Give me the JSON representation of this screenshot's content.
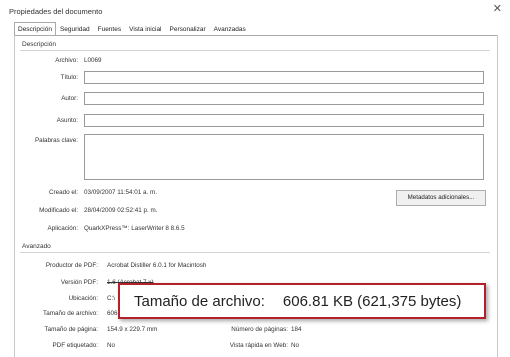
{
  "window": {
    "title": "Propiedades del documento"
  },
  "tabs": [
    "Descripción",
    "Seguridad",
    "Fuentes",
    "Vista inicial",
    "Personalizar",
    "Avanzadas"
  ],
  "descripcion": {
    "section_title": "Descripción",
    "archivo_label": "Archivo:",
    "archivo_value": "L0069",
    "titulo_label": "Título:",
    "autor_label": "Autor:",
    "asunto_label": "Asunto:",
    "palabras_label": "Palabras clave:",
    "creado_label": "Creado el:",
    "creado_value": "03/09/2007 11:54:01 a. m.",
    "modificado_label": "Modificado el:",
    "modificado_value": "28/04/2009 02:52:41 p. m.",
    "aplicacion_label": "Aplicación:",
    "aplicacion_value": "QuarkXPress™: LaserWriter 8 8.6.5",
    "metadatos_button": "Metadatos adicionales..."
  },
  "avanzado": {
    "section_title": "Avanzado",
    "productor_label": "Productor de PDF:",
    "productor_value": "Acrobat Distiller 6.0.1 for Macintosh",
    "version_label": "Versión PDF:",
    "version_value": "1.6 (Acrobat 7.x)",
    "ubicacion_label": "Ubicación:",
    "ubicacion_value": "C:\\",
    "tamano_archivo_label": "Tamaño de archivo:",
    "tamano_archivo_value": "606",
    "tamano_pagina_label": "Tamaño de página:",
    "tamano_pagina_value": "154.9 x 229.7 mm",
    "numero_paginas_label": "Número de páginas:",
    "numero_paginas_value": "184",
    "pdf_etiquetado_label": "PDF etiquetado:",
    "pdf_etiquetado_value": "No",
    "vista_rapida_label": "Vista rápida en Web:",
    "vista_rapida_value": "No"
  },
  "callout": {
    "label": "Tamaño de archivo:",
    "value": "606.81 KB (621,375 bytes)"
  }
}
